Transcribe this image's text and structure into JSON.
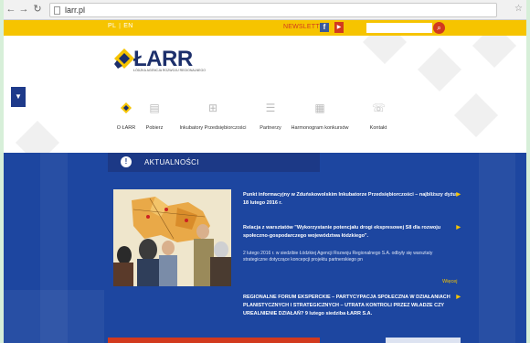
{
  "browser": {
    "url": "larr.pl"
  },
  "topbar": {
    "lang_pl": "PL",
    "lang_en": "EN",
    "newsletter": "NEWSLETTER"
  },
  "logo": {
    "name": "ŁARR",
    "subtitle": "ŁÓDZKA AGENCJA ROZWOJU REGIONALNEGO"
  },
  "nav": [
    {
      "label": "O ŁARR",
      "icon": "logo-icon"
    },
    {
      "label": "Pobierz",
      "icon": "document-icon"
    },
    {
      "label": "Inkubatory Przedsiębiorczości",
      "icon": "incubator-icon"
    },
    {
      "label": "Partnerzy",
      "icon": "people-icon"
    },
    {
      "label": "Harmonogram konkursów",
      "icon": "calendar-icon"
    },
    {
      "label": "Kontakt",
      "icon": "phone-icon"
    }
  ],
  "news": {
    "tab_title": "AKTUALNOŚCI",
    "items": [
      "Punkt informacyjny w Zduńskowolskim Inkubatorze Przedsiębiorczości – najbliższy dyżur 18 lutego 2016 r.",
      "Relacja z warsztatów \"Wykorzystanie potencjału drogi ekspresowej S8 dla rozwoju społeczno-gospodarczego województwa łódzkiego\".",
      "REGIONALNE FORUM EKSPERCKIE – PARTYCYPACJA SPOŁECZNA W DZIAŁANIACH PLANISTYCZNYCH I STRATEGICZNYCH – UTRATA KONTROLI PRZEZ WŁADZE CZY UREALNIENIE DZIAŁAŃ? 9 lutego siedziba ŁARR S.A."
    ],
    "body": "2 lutego 2016 r. w siedzibie Łódzkiej Agencji Rozwoju Regionalnego S.A. odbyły się warsztaty strategiczne dotyczące koncepcji projektu partnerskiego pn",
    "more": "Więcej"
  },
  "colors": {
    "yellow": "#f6c400",
    "blue": "#1d46a0",
    "navy": "#1c2f6b",
    "red": "#d23a1e"
  }
}
